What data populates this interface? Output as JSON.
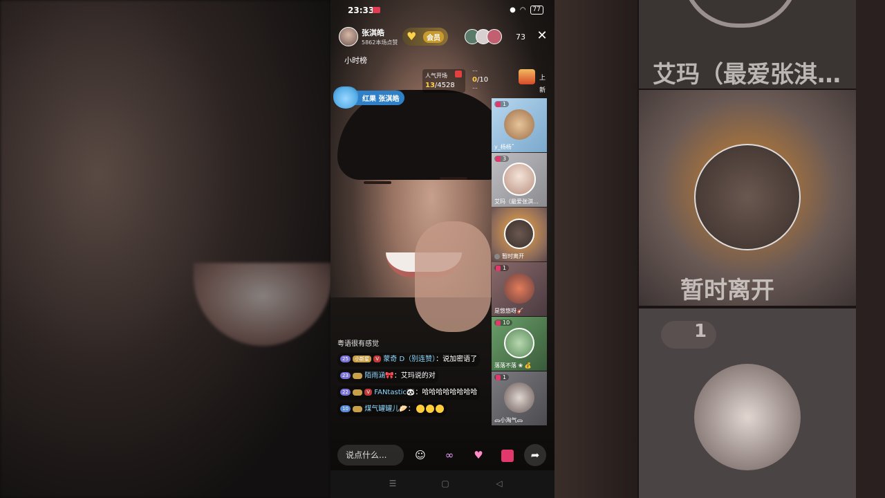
{
  "status": {
    "time": "23:33",
    "battery": "77"
  },
  "host": {
    "name": "张淇皓",
    "likes": "5862本场点赞"
  },
  "vip": {
    "label": "会员"
  },
  "viewer_count": "73",
  "hourly_rank": "小时榜",
  "popularity": {
    "label": "人气开场",
    "current": "13",
    "total": "/4528"
  },
  "task": {
    "line1": "…",
    "current": "0",
    "total": "/10",
    "line3": "…"
  },
  "new_tag": "上新",
  "fan_badge": {
    "label": "红果 张淇皓"
  },
  "guests": [
    {
      "level": "1",
      "name": "y_杨杨˚",
      "muted": false
    },
    {
      "level": "3",
      "name": "艾玛（最爱张淇…",
      "muted": false
    },
    {
      "level": "",
      "name": "暂时离开",
      "muted": true
    },
    {
      "level": "1",
      "name": "是悠悠呀🎸",
      "muted": false
    },
    {
      "level": "10",
      "name": "落落不落 ❀ 💰",
      "muted": false
    },
    {
      "level": "1",
      "name": "ᯅ小淘气ᯅ",
      "muted": false
    }
  ],
  "chat": {
    "system": "粤语很有感觉",
    "messages": [
      {
        "level": "25",
        "badge": "小新星",
        "user": "蒙奇 D（别连赞）",
        "text": "说加密语了"
      },
      {
        "level": "23",
        "user": "陌雨涵🎀",
        "text": "艾玛说的对"
      },
      {
        "level": "22",
        "user": "FANtastic🐼",
        "text": "哈哈哈哈哈哈哈哈"
      },
      {
        "level": "10",
        "user": "煤气罐罐儿🥟",
        "text": ""
      }
    ]
  },
  "input": {
    "placeholder": "说点什么..."
  },
  "backdrop": {
    "text1": "艾玛（最爱张淇…",
    "text2": "暂时离开",
    "level": "1"
  },
  "icons": {
    "emoji": "smile-icon",
    "link": "link-icon",
    "gift": "heart-gift-icon",
    "box": "gift-box-icon",
    "share": "share-icon"
  }
}
